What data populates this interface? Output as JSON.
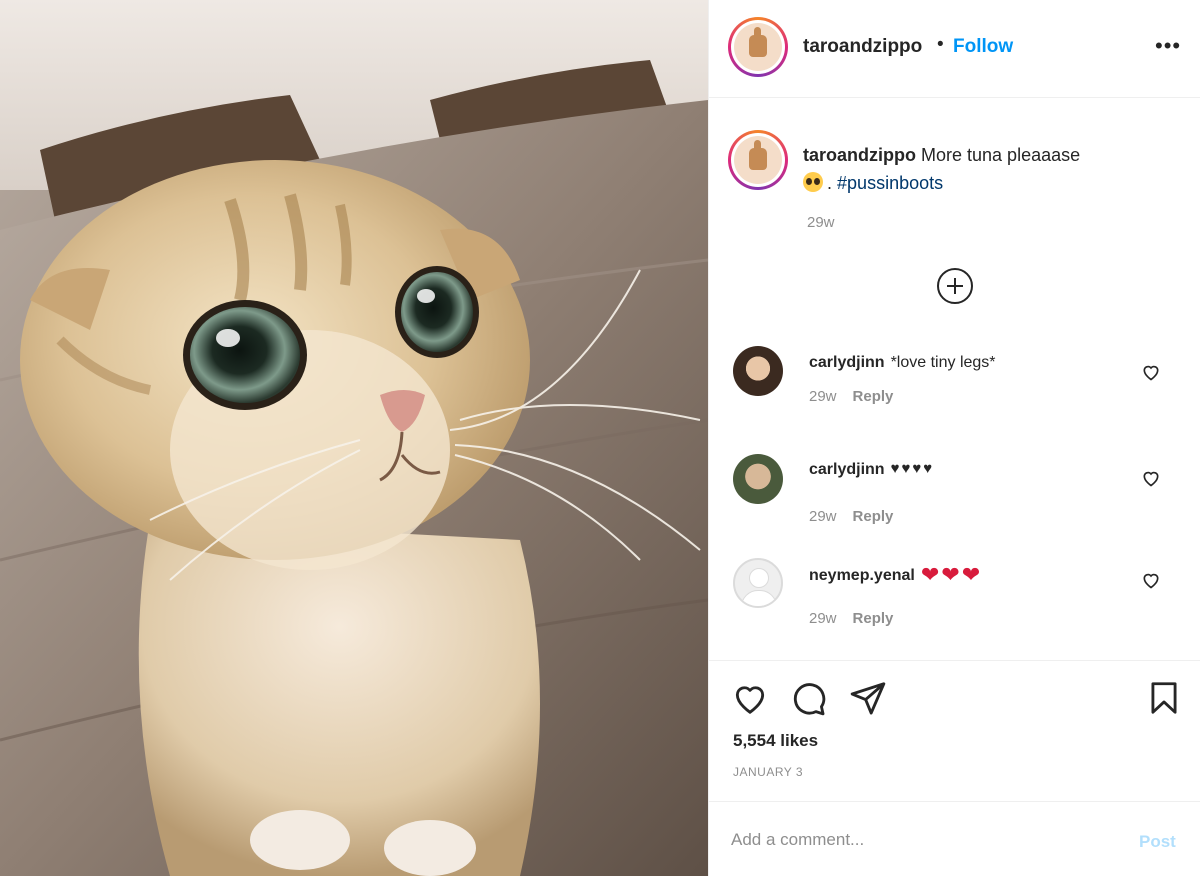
{
  "post": {
    "username": "taroandzippo",
    "separator": "•",
    "follow_label": "Follow",
    "more_icon": "more-options-icon"
  },
  "caption": {
    "username": "taroandzippo",
    "text": "More tuna pleaaase",
    "emoji": "pleading-face-emoji",
    "separator": ".",
    "hashtag": "#pussinboots",
    "time": "29w"
  },
  "comments": [
    {
      "username": "carlydjinn",
      "text": "*love tiny legs*",
      "time": "29w",
      "reply_label": "Reply"
    },
    {
      "username": "carlydjinn",
      "text": "♥♥♥♥",
      "time": "29w",
      "reply_label": "Reply"
    },
    {
      "username": "neymep.yenal",
      "text": "❤❤❤",
      "time": "29w",
      "reply_label": "Reply"
    }
  ],
  "actions": {
    "likes": "5,554 likes",
    "date": "JANUARY 3"
  },
  "add_comment": {
    "placeholder": "Add a comment...",
    "post_label": "Post"
  },
  "colors": {
    "link_blue": "#0095f6",
    "post_disabled": "#b2dffc",
    "heart_red": "#d81b3c",
    "muted": "#8e8e8e"
  }
}
